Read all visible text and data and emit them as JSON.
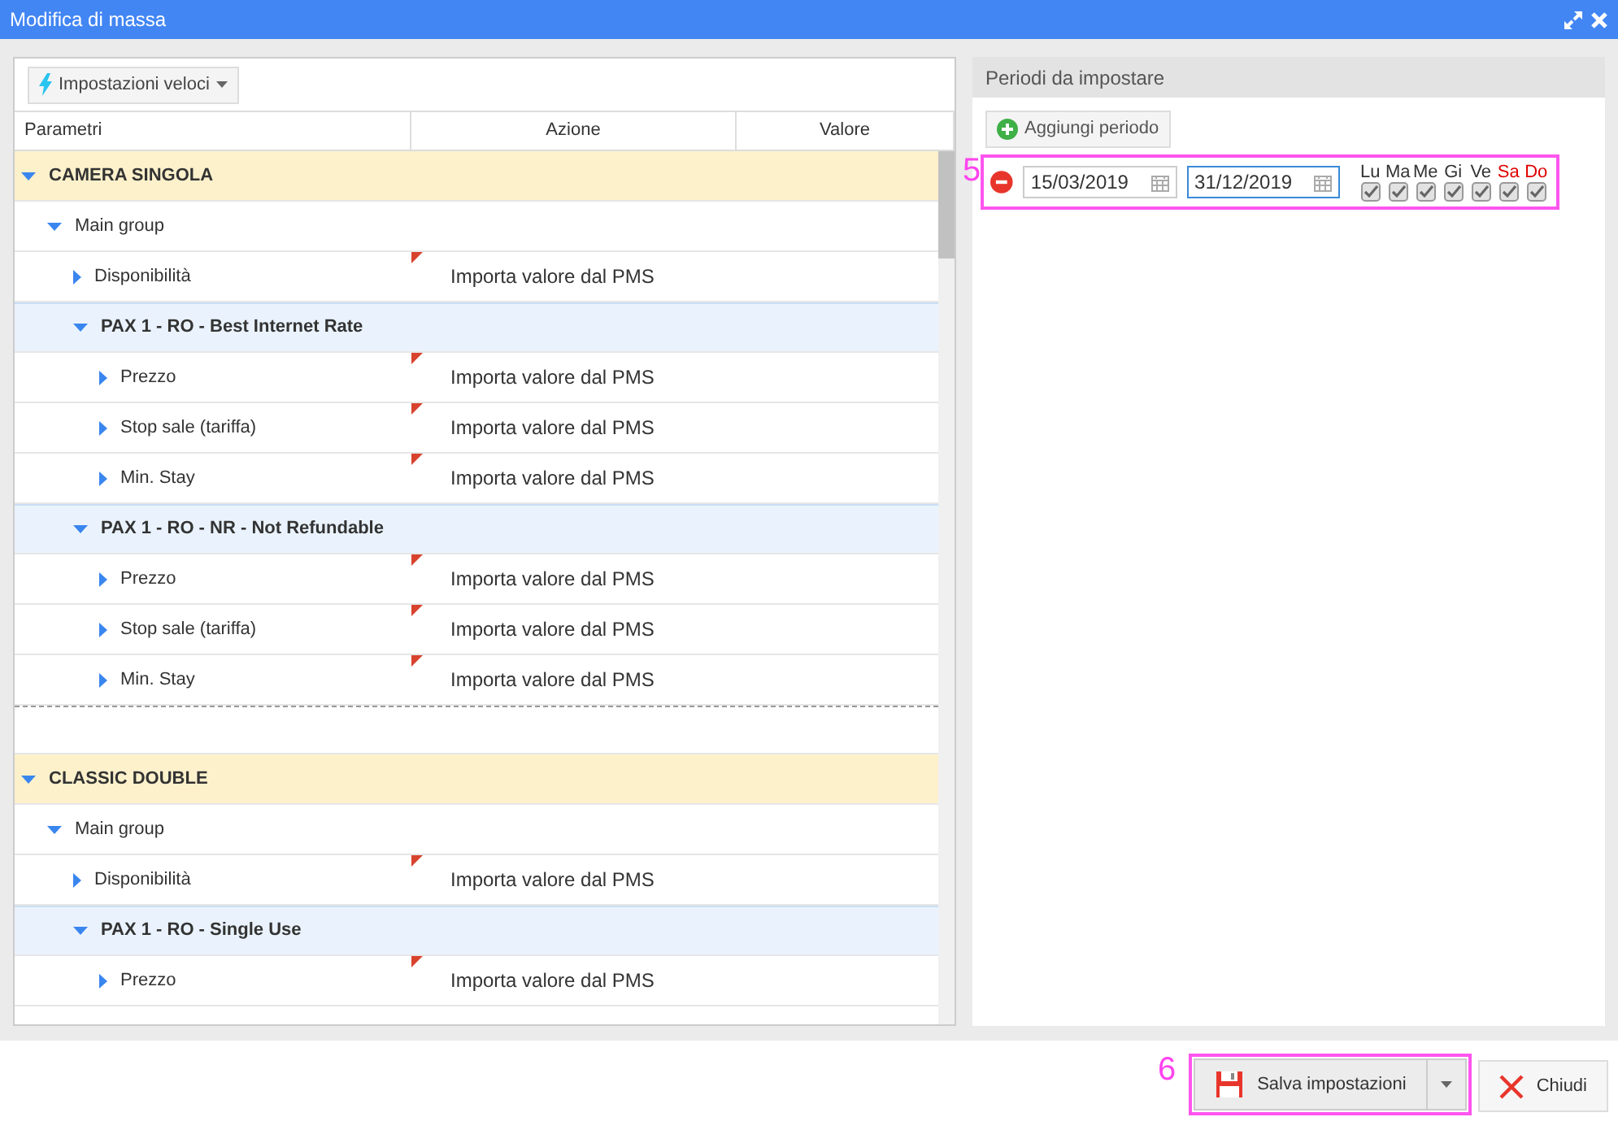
{
  "window": {
    "title": "Modifica di massa"
  },
  "toolbar": {
    "quick_settings": "Impostazioni veloci"
  },
  "table": {
    "columns": [
      "Parametri",
      "Azione",
      "Valore"
    ],
    "rows": [
      {
        "kind": "room",
        "label": "CAMERA SINGOLA",
        "expanded": true,
        "children": [
          {
            "kind": "group",
            "label": "Main group",
            "expanded": true,
            "children": [
              {
                "kind": "param",
                "label": "Disponibilità",
                "expanded": false,
                "action": "Importa valore dal PMS"
              },
              {
                "kind": "rate",
                "label": "PAX 1 - RO - Best Internet Rate",
                "expanded": true,
                "children": [
                  {
                    "kind": "param",
                    "label": "Prezzo",
                    "expanded": false,
                    "action": "Importa valore dal PMS"
                  },
                  {
                    "kind": "param",
                    "label": "Stop sale (tariffa)",
                    "expanded": false,
                    "action": "Importa valore dal PMS"
                  },
                  {
                    "kind": "param",
                    "label": "Min. Stay",
                    "expanded": false,
                    "action": "Importa valore dal PMS"
                  }
                ]
              },
              {
                "kind": "rate",
                "label": "PAX 1 - RO - NR - Not Refundable",
                "expanded": true,
                "children": [
                  {
                    "kind": "param",
                    "label": "Prezzo",
                    "expanded": false,
                    "action": "Importa valore dal PMS"
                  },
                  {
                    "kind": "param",
                    "label": "Stop sale (tariffa)",
                    "expanded": false,
                    "action": "Importa valore dal PMS"
                  },
                  {
                    "kind": "param",
                    "label": "Min. Stay",
                    "expanded": false,
                    "action": "Importa valore dal PMS"
                  }
                ]
              }
            ]
          }
        ]
      },
      {
        "kind": "separator"
      },
      {
        "kind": "room",
        "label": "CLASSIC DOUBLE",
        "expanded": true,
        "children": [
          {
            "kind": "group",
            "label": "Main group",
            "expanded": true,
            "children": [
              {
                "kind": "param",
                "label": "Disponibilità",
                "expanded": false,
                "action": "Importa valore dal PMS"
              },
              {
                "kind": "rate",
                "label": "PAX 1 - RO - Single Use",
                "expanded": true,
                "children": [
                  {
                    "kind": "param",
                    "label": "Prezzo",
                    "expanded": false,
                    "action": "Importa valore dal PMS"
                  }
                ]
              }
            ]
          }
        ]
      }
    ]
  },
  "periods": {
    "title": "Periodi da impostare",
    "add_button": "Aggiungi periodo",
    "items": [
      {
        "from": "15/03/2019",
        "to": "31/12/2019",
        "to_focused": true,
        "days": [
          {
            "label": "Lu",
            "checked": true,
            "color": "#333333"
          },
          {
            "label": "Ma",
            "checked": true,
            "color": "#333333"
          },
          {
            "label": "Me",
            "checked": true,
            "color": "#333333"
          },
          {
            "label": "Gi",
            "checked": true,
            "color": "#333333"
          },
          {
            "label": "Ve",
            "checked": true,
            "color": "#333333"
          },
          {
            "label": "Sa",
            "checked": true,
            "color": "#e00000"
          },
          {
            "label": "Do",
            "checked": true,
            "color": "#e00000"
          }
        ]
      }
    ]
  },
  "callouts": [
    "5",
    "6"
  ],
  "footer": {
    "save_button": "Salva impostazioni",
    "close_button": "Chiudi"
  }
}
